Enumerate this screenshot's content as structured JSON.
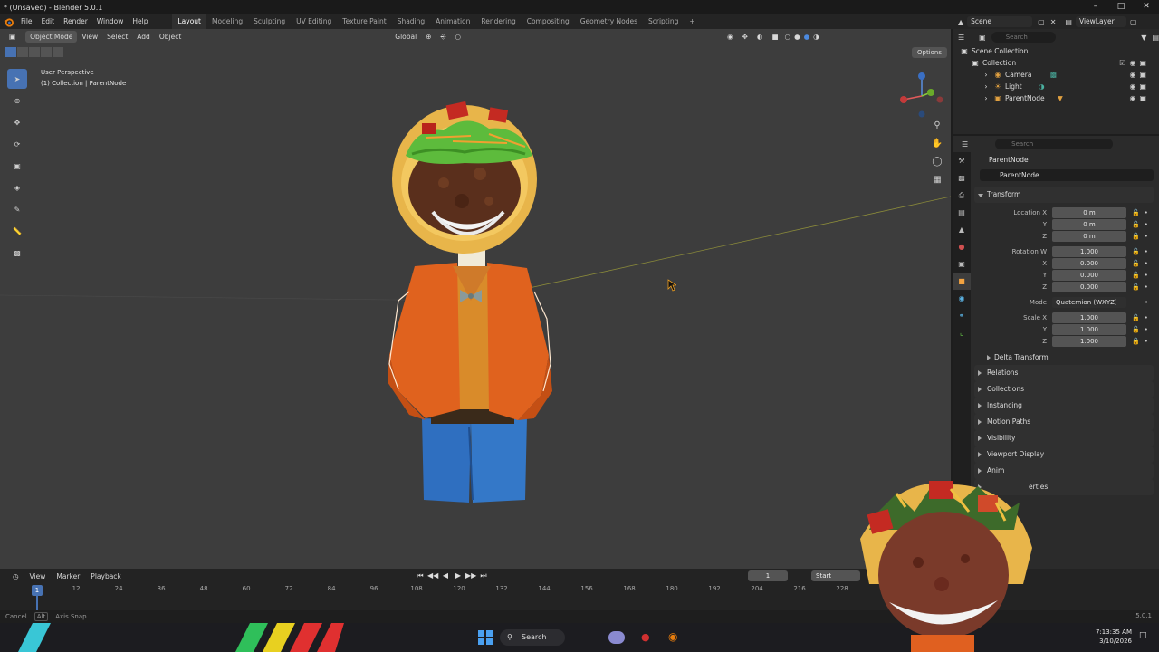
{
  "window": {
    "title": "* (Unsaved) - Blender 5.0.1"
  },
  "menu": [
    "File",
    "Edit",
    "Render",
    "Window",
    "Help"
  ],
  "workspaces": [
    "Layout",
    "Modeling",
    "Sculpting",
    "UV Editing",
    "Texture Paint",
    "Shading",
    "Animation",
    "Rendering",
    "Compositing",
    "Geometry Nodes",
    "Scripting"
  ],
  "active_workspace": "Layout",
  "top_right": {
    "scene": "Scene",
    "view_layer": "ViewLayer"
  },
  "viewport": {
    "mode": "Object Mode",
    "header_menus": [
      "View",
      "Select",
      "Add",
      "Object"
    ],
    "orientation": "Global",
    "options": "Options",
    "view_name": "User Perspective",
    "collection_path": "(1) Collection | ParentNode"
  },
  "outliner": {
    "search_placeholder": "Search",
    "items": [
      {
        "label": "Scene Collection",
        "level": 0
      },
      {
        "label": "Collection",
        "level": 1
      },
      {
        "label": "Camera",
        "level": 2
      },
      {
        "label": "Light",
        "level": 2
      },
      {
        "label": "ParentNode",
        "level": 2
      }
    ]
  },
  "properties": {
    "search_placeholder": "Search",
    "object_name": "ParentNode",
    "name_field": "ParentNode",
    "transform": {
      "header": "Transform",
      "location_label": "Location X",
      "location": [
        "0 m",
        "0 m",
        "0 m"
      ],
      "rotation_label": "Rotation W",
      "rotation": [
        "1.000",
        "0.000",
        "0.000",
        "0.000"
      ],
      "mode_label": "Mode",
      "mode_value": "Quaternion (WXYZ)",
      "scale_label": "Scale X",
      "scale": [
        "1.000",
        "1.000",
        "1.000"
      ],
      "axis": [
        "X",
        "Y",
        "Z"
      ],
      "delta": "Delta Transform"
    },
    "panels": [
      "Relations",
      "Collections",
      "Instancing",
      "Motion Paths",
      "Visibility",
      "Viewport Display",
      "Anim",
      "erties"
    ]
  },
  "timeline": {
    "menus": [
      "View",
      "Marker",
      "Playback"
    ],
    "current_frame": "1",
    "start_label": "Start",
    "playhead": "1",
    "ticks": [
      "12",
      "24",
      "36",
      "48",
      "60",
      "72",
      "84",
      "96",
      "108",
      "120",
      "132",
      "144",
      "156",
      "168",
      "180",
      "192",
      "204",
      "216",
      "228"
    ]
  },
  "statusbar": {
    "cancel": "Cancel",
    "alt": "Alt",
    "axis_snap": "Axis Snap",
    "version": "5.0.1"
  },
  "taskbar": {
    "search": "Search",
    "time": "7:13:35 AM",
    "date": "3/10/2026"
  },
  "colors": {
    "accent": "#4772b3",
    "active_orange": "#f2a341",
    "viewport_bg": "#3d3d3d"
  }
}
